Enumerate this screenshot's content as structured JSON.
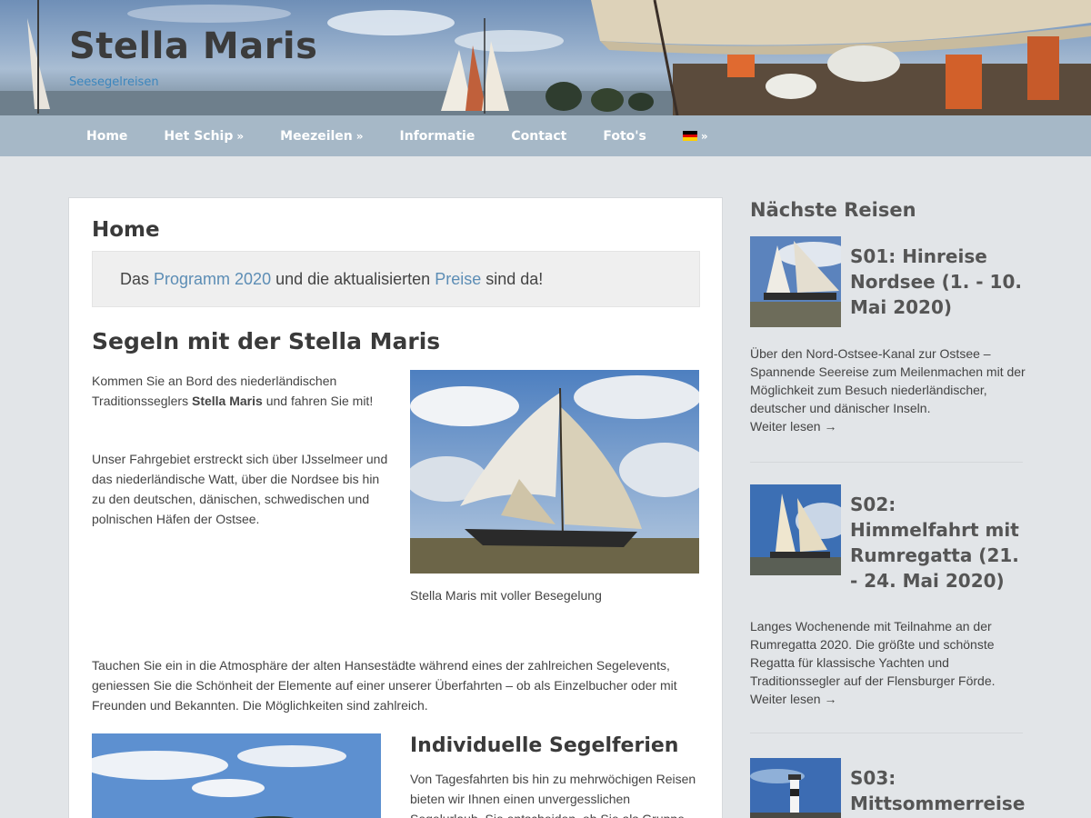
{
  "site": {
    "title": "Stella Maris",
    "tagline": "Seesegelreisen"
  },
  "nav": {
    "items": [
      {
        "label": "Home",
        "has_submenu": false
      },
      {
        "label": "Het Schip",
        "has_submenu": true
      },
      {
        "label": "Meezeilen",
        "has_submenu": true
      },
      {
        "label": "Informatie",
        "has_submenu": false
      },
      {
        "label": "Contact",
        "has_submenu": false
      },
      {
        "label": "Foto's",
        "has_submenu": false
      }
    ],
    "language_icon": "german-flag-icon",
    "chevron": "»"
  },
  "main": {
    "page_title": "Home",
    "notice": {
      "pre": "Das ",
      "link1": "Programm 2020",
      "mid": " und die aktualisierten ",
      "link2": "Preise",
      "post": " sind da!"
    },
    "heading": "Segeln mit der Stella Maris",
    "intro": {
      "pre": "Kommen Sie an Bord des niederländischen Traditionsseglers ",
      "bold": "Stella Maris",
      "post": " und fahren Sie mit!"
    },
    "paragraph2": "Unser Fahrgebiet erstreckt sich über IJsselmeer und das niederländische Watt, über die Nordsee bis hin zu den deutschen, dänischen, schwedischen und polnischen Häfen der Ostsee.",
    "photo_caption": "Stella Maris mit voller Besegelung",
    "paragraph3": "Tauchen Sie ein in die Atmosphäre der alten Hansestädte während eines der zahlreichen Segelevents, geniessen Sie die Schönheit der Elemente auf einer unserer Überfahrten – ob als Einzelbucher oder mit Freunden und Bekannten. Die Möglichkeiten sind zahlreich.",
    "subheading": "Individuelle Segelferien",
    "paragraph4": "Von Tagesfahrten bis hin zu mehrwöchigen Reisen bieten wir Ihnen einen unvergesslichen Segelurlaub. Sie entscheiden, ob Sie als Gruppe"
  },
  "sidebar": {
    "title": "Nächste Reisen",
    "read_more": "Weiter lesen →",
    "trips": [
      {
        "title": "S01: Hinreise Nordsee (1. - 10. Mai 2020)",
        "description": "Über den Nord-Ostsee-Kanal zur Ostsee – Spannende Seereise zum Meilenmachen mit der Möglichkeit zum Besuch niederländischer, deutscher und dänischer Inseln."
      },
      {
        "title": "S02: Himmelfahrt mit Rumregatta (21. - 24. Mai 2020)",
        "description": "Langes Wochenende mit Teilnahme an der Rumregatta 2020. Die größte und schönste Regatta für klassische Yachten und Traditionssegler auf der Flensburger Förde."
      },
      {
        "title": "S03: Mittsommerreise",
        "description": ""
      }
    ]
  },
  "colors": {
    "nav_bg": "#a6b8c7",
    "page_bg": "#e2e5e8",
    "link": "#5c8db5",
    "tagline": "#3c86bd"
  }
}
